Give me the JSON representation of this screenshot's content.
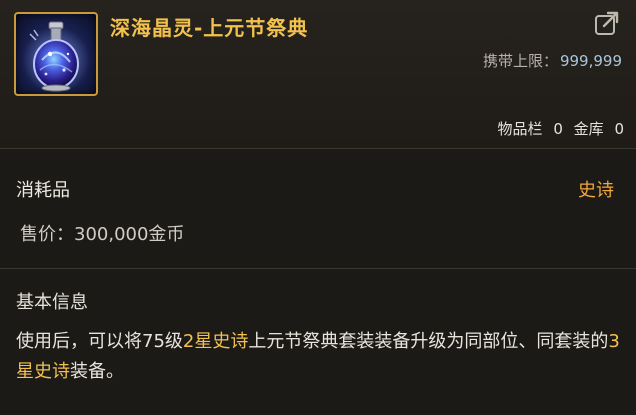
{
  "item": {
    "title": "深海晶灵-上元节祭典",
    "carry_label": "携带上限：",
    "carry_value": "999,999",
    "inventory_label": "物品栏",
    "inventory_count": "0",
    "storage_label": "金库",
    "storage_count": "0",
    "category": "消耗品",
    "rarity": "史诗",
    "price_label": "售价：",
    "price_value": "300,000金币",
    "info_heading": "基本信息",
    "desc_part1": "使用后，可以将75级",
    "desc_hl1": "2星史诗",
    "desc_part2": "上元节祭典套装装备升级为同部位、同套装的",
    "desc_hl2": "3星史诗",
    "desc_part3": "装备。"
  },
  "colors": {
    "title": "#f2c14e",
    "rarity": "#f2a83a",
    "highlight": "#f2c14e",
    "frame": "#c99a3c"
  },
  "icons": {
    "item": "potion-bottle-icon",
    "share": "share-link-icon"
  }
}
